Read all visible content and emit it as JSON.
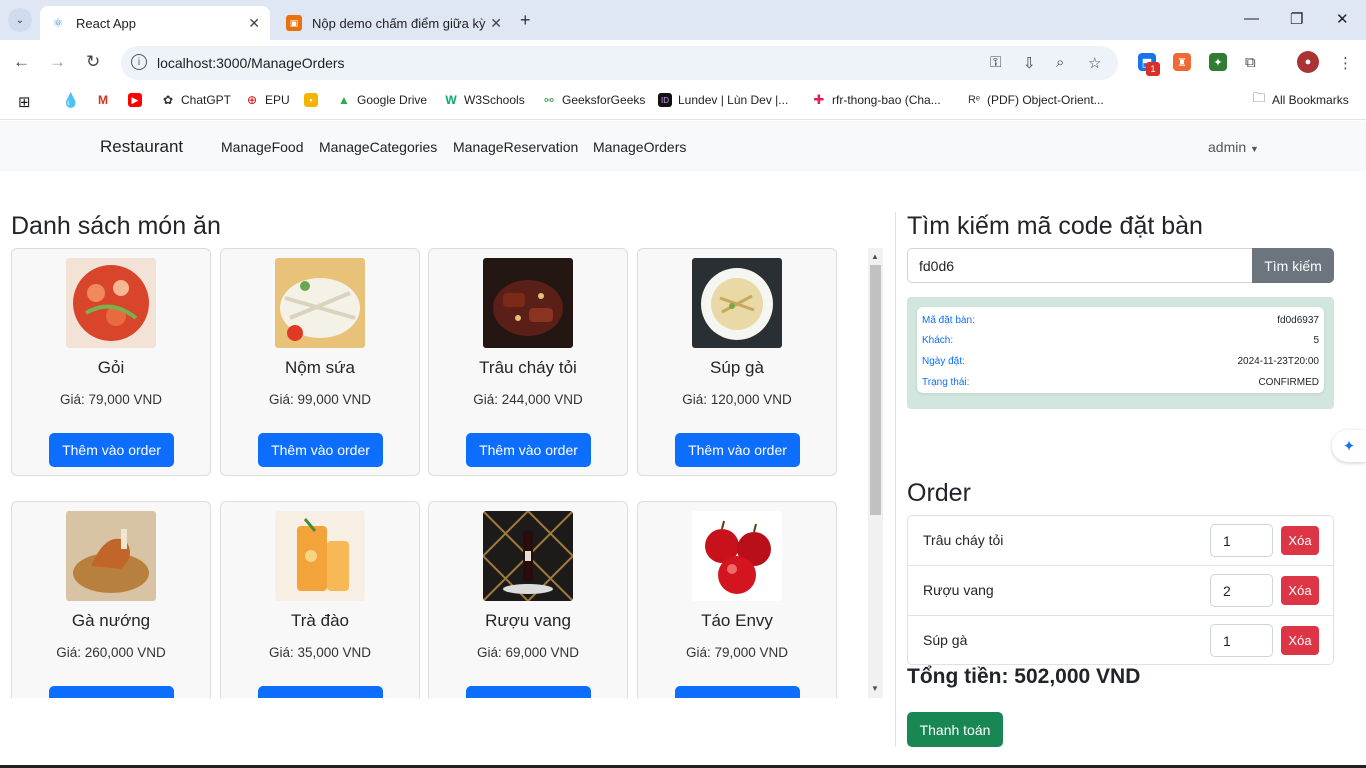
{
  "browser": {
    "tabs": [
      {
        "title": "React App",
        "active": true
      },
      {
        "title": "Nộp demo chấm điểm giữa kỳ",
        "active": false
      }
    ],
    "url": "localhost:3000/ManageOrders",
    "extension_badge": "1",
    "bookmarks": [
      {
        "label": "ChatGPT"
      },
      {
        "label": "EPU"
      },
      {
        "label": "Google Drive"
      },
      {
        "label": "W3Schools"
      },
      {
        "label": "GeeksforGeeks"
      },
      {
        "label": "Lundev | Lùn Dev |..."
      },
      {
        "label": "rfr-thong-bao (Cha..."
      },
      {
        "label": "(PDF) Object-Orient..."
      }
    ],
    "all_bookmarks": "All Bookmarks"
  },
  "navbar": {
    "brand": "Restaurant",
    "links": [
      "ManageFood",
      "ManageCategories",
      "ManageReservation",
      "ManageOrders"
    ],
    "user": "admin"
  },
  "menu": {
    "title": "Danh sách món ăn",
    "add_label": "Thêm vào order",
    "items": [
      {
        "name": "Gỏi",
        "price": "Giá: 79,000 VND",
        "image": "salad"
      },
      {
        "name": "Nộm sứa",
        "price": "Giá: 99,000 VND",
        "image": "jellyfish-salad"
      },
      {
        "name": "Trâu cháy tỏi",
        "price": "Giá: 244,000 VND",
        "image": "garlic-buffalo"
      },
      {
        "name": "Súp gà",
        "price": "Giá: 120,000 VND",
        "image": "chicken-soup"
      },
      {
        "name": "Gà nướng",
        "price": "Giá: 260,000 VND",
        "image": "grilled-chicken"
      },
      {
        "name": "Trà đào",
        "price": "Giá: 35,000 VND",
        "image": "peach-tea"
      },
      {
        "name": "Rượu vang",
        "price": "Giá: 69,000 VND",
        "image": "wine"
      },
      {
        "name": "Táo Envy",
        "price": "Giá: 79,000 VND",
        "image": "apples"
      }
    ]
  },
  "search": {
    "title": "Tìm kiếm mã code đặt bàn",
    "value": "fd0d6",
    "button": "Tìm kiếm",
    "result": {
      "code_label": "Mã đặt bàn:",
      "code": "fd0d6937",
      "guests_label": "Khách:",
      "guests": "5",
      "date_label": "Ngày đặt:",
      "date": "2024-11-23T20:00",
      "status_label": "Trạng thái:",
      "status": "CONFIRMED"
    }
  },
  "order": {
    "title": "Order",
    "delete_label": "Xóa",
    "items": [
      {
        "name": "Trâu cháy tỏi",
        "qty": "1"
      },
      {
        "name": "Rượu vang",
        "qty": "2"
      },
      {
        "name": "Súp gà",
        "qty": "1"
      }
    ],
    "total": "Tổng tiền: 502,000 VND",
    "pay": "Thanh toán"
  },
  "colors": {
    "primary": "#0d6efd",
    "danger": "#dc3545",
    "success": "#198754",
    "secondary": "#6c757d",
    "result_bg": "#d1e7dd"
  }
}
